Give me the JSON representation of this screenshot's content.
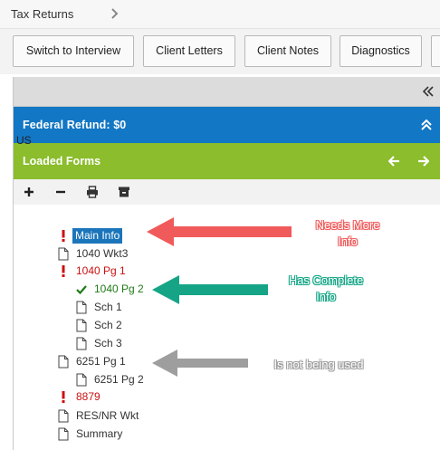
{
  "breadcrumb": {
    "label": "Tax Returns"
  },
  "toolbar": {
    "buttons": [
      {
        "label": "Switch to Interview"
      },
      {
        "label": "Client Letters"
      },
      {
        "label": "Client Notes"
      },
      {
        "label": "Diagnostics"
      }
    ]
  },
  "bars": {
    "federal": "Federal  Refund:  $0",
    "loaded": "Loaded Forms"
  },
  "tree": {
    "root": "US",
    "nodes": [
      {
        "label": "Main Info",
        "status": "needs-info",
        "icon": "exclamation-icon",
        "color": "#1b75bb"
      },
      {
        "label": "1040 Wkt3",
        "status": "unused",
        "icon": "document-icon"
      },
      {
        "label": "1040 Pg 1",
        "status": "needs-info",
        "icon": "exclamation-icon",
        "color": "#cc1111"
      },
      {
        "label": "1040 Pg 2",
        "status": "complete",
        "icon": "checkmark-icon",
        "color": "#1f7a18"
      },
      {
        "label": "Sch 1",
        "status": "unused",
        "icon": "document-icon"
      },
      {
        "label": "Sch 2",
        "status": "unused",
        "icon": "document-icon"
      },
      {
        "label": "Sch 3",
        "status": "unused",
        "icon": "document-icon"
      },
      {
        "label": "6251 Pg 1",
        "status": "unused",
        "icon": "document-icon"
      },
      {
        "label": "6251 Pg 2",
        "status": "unused",
        "icon": "document-icon"
      },
      {
        "label": "8879",
        "status": "needs-info",
        "icon": "exclamation-icon",
        "color": "#cc1111"
      },
      {
        "label": "RES/NR Wkt",
        "status": "unused",
        "icon": "document-icon"
      },
      {
        "label": "Summary",
        "status": "unused",
        "icon": "document-icon"
      }
    ]
  },
  "annotations": {
    "needs_more_info": {
      "line1": "Needs More",
      "line2": "Info",
      "color": "#f05a5a"
    },
    "has_complete_info": {
      "line1": "Has Complete",
      "line2": "Info",
      "color": "#15a586"
    },
    "not_used": {
      "line1": "Is not being used",
      "color": "#9e9e9e"
    }
  }
}
